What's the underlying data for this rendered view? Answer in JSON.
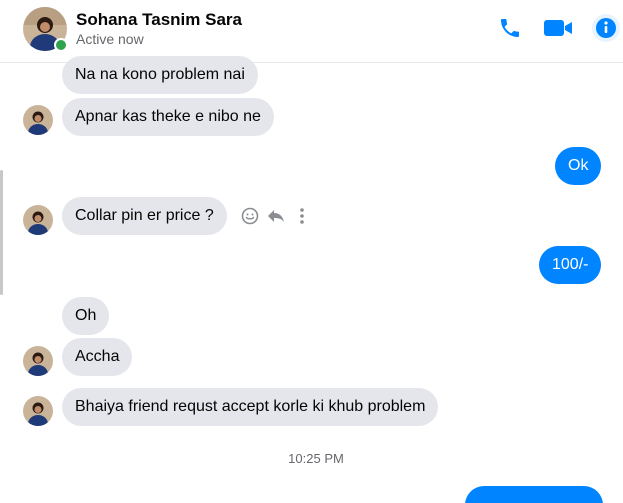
{
  "header": {
    "name": "Sohana Tasnim Sara",
    "status": "Active now",
    "colors": {
      "accent": "#0084ff",
      "online": "#31a24c"
    },
    "icons": [
      "phone-icon",
      "video-camera-icon",
      "info-icon"
    ]
  },
  "messages": [
    {
      "from": "them",
      "text": "Na na kono problem nai"
    },
    {
      "from": "them",
      "text": "Apnar kas theke e nibo ne"
    },
    {
      "from": "me",
      "text": "Ok"
    },
    {
      "from": "them",
      "text": "Collar pin er price ?"
    },
    {
      "from": "me",
      "text": "100/-"
    },
    {
      "from": "them",
      "text": "Oh"
    },
    {
      "from": "them",
      "text": "Accha"
    },
    {
      "from": "them",
      "text": "Bhaiya friend requst accept korle ki khub problem"
    }
  ],
  "message_actions": [
    "emoji-react-icon",
    "reply-icon",
    "more-options-icon"
  ],
  "timestamp": "10:25 PM"
}
